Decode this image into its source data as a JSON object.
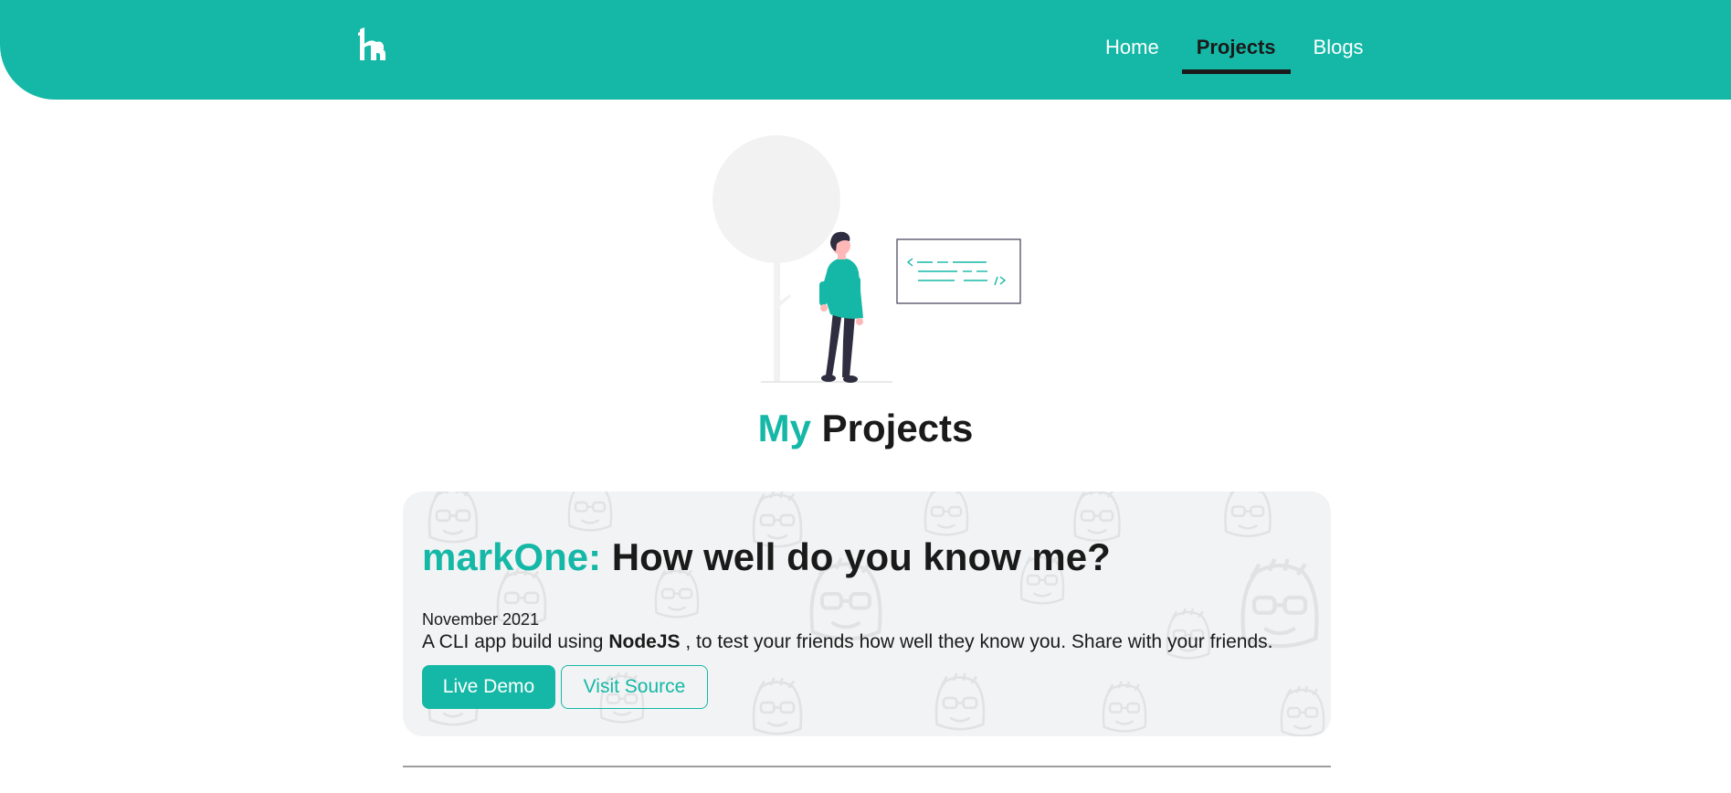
{
  "header": {
    "logo_icon": "logo-icon",
    "nav": [
      {
        "label": "Home",
        "active": false
      },
      {
        "label": "Projects",
        "active": true
      },
      {
        "label": "Blogs",
        "active": false
      }
    ]
  },
  "colors": {
    "accent": "#15b8a6",
    "text": "#1a1a1a",
    "card_bg": "#f2f3f4"
  },
  "page_title": {
    "accent": "My",
    "rest": "Projects"
  },
  "project": {
    "name": "markOne:",
    "tagline": "How well do you know me?",
    "date": "November 2021",
    "desc_before": "A CLI app build using",
    "desc_bold": "NodeJS",
    "desc_after": ", to test your friends how well they know you. Share with your friends.",
    "live_demo_label": "Live Demo",
    "visit_source_label": "Visit Source"
  }
}
